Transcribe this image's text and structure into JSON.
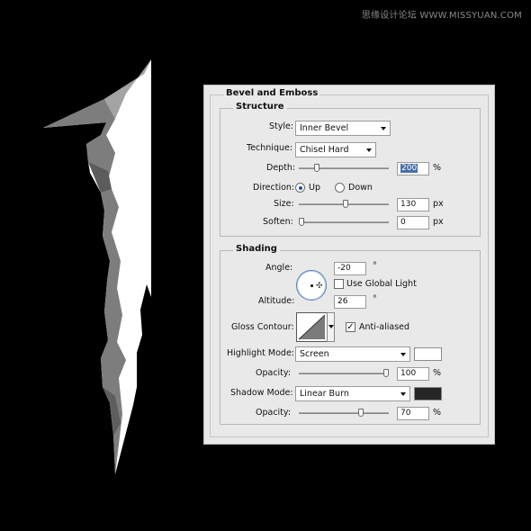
{
  "watermark": "思缘设计论坛 WWW.MISSYUAN.COM",
  "panel": {
    "title": "Bevel and Emboss",
    "structure": {
      "title": "Structure",
      "style_label": "Style:",
      "style_value": "Inner Bevel",
      "technique_label": "Technique:",
      "technique_value": "Chisel Hard",
      "depth_label": "Depth:",
      "depth_value": "200",
      "depth_unit": "%",
      "depth_slider_fraction": 0.18,
      "direction_label": "Direction:",
      "direction_up": "Up",
      "direction_down": "Down",
      "direction_selected": "Up",
      "size_label": "Size:",
      "size_value": "130",
      "size_unit": "px",
      "size_slider_fraction": 0.52,
      "soften_label": "Soften:",
      "soften_value": "0",
      "soften_unit": "px",
      "soften_slider_fraction": 0.0
    },
    "shading": {
      "title": "Shading",
      "angle_label": "Angle:",
      "angle_value": "-20",
      "angle_unit": "°",
      "use_global_light_label": "Use Global Light",
      "use_global_light_checked": false,
      "altitude_label": "Altitude:",
      "altitude_value": "26",
      "altitude_unit": "°",
      "gloss_contour_label": "Gloss Contour:",
      "anti_aliased_label": "Anti-aliased",
      "anti_aliased_checked": true,
      "highlight_mode_label": "Highlight Mode:",
      "highlight_mode_value": "Screen",
      "highlight_color": "#ffffff",
      "highlight_opacity_label": "Opacity:",
      "highlight_opacity_value": "100",
      "highlight_opacity_unit": "%",
      "highlight_opacity_fraction": 1.0,
      "shadow_mode_label": "Shadow Mode:",
      "shadow_mode_value": "Linear Burn",
      "shadow_color": "#262626",
      "shadow_opacity_label": "Opacity:",
      "shadow_opacity_value": "70",
      "shadow_opacity_unit": "%",
      "shadow_opacity_fraction": 0.7
    }
  }
}
